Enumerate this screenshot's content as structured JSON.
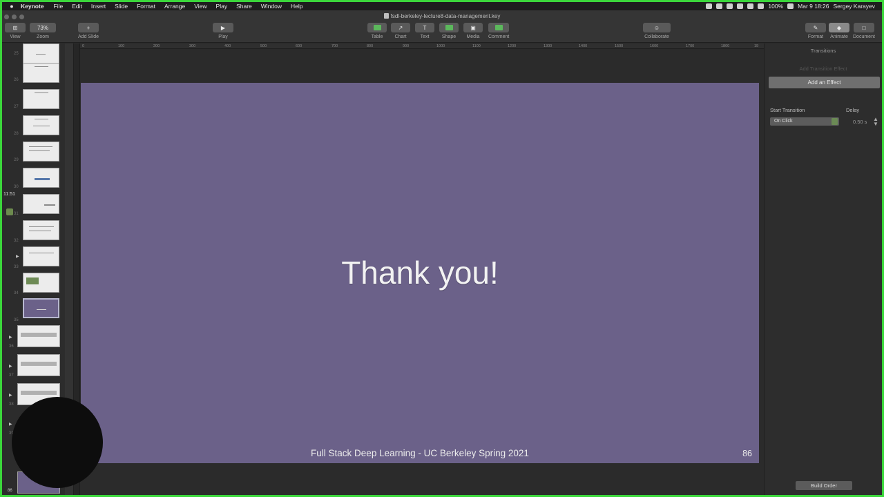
{
  "menubar": {
    "app": "Keynote",
    "items": [
      "File",
      "Edit",
      "Insert",
      "Slide",
      "Format",
      "Arrange",
      "View",
      "Play",
      "Share",
      "Window",
      "Help"
    ],
    "battery": "100%",
    "clock": "Mar 9  18:26",
    "user": "Sergey Karayev"
  },
  "window": {
    "title": "fsdl-berkeley-lecture8-data-management.key"
  },
  "toolbar": {
    "view_value": "⊞",
    "view_label": "View",
    "zoom_value": "73%",
    "zoom_label": "Zoom",
    "add_slide_label": "Add Slide",
    "play_label": "Play",
    "table_label": "Table",
    "chart_label": "Chart",
    "text_label": "Text",
    "shape_label": "Shape",
    "media_label": "Media",
    "comment_label": "Comment",
    "collaborate_label": "Collaborate",
    "format_label": "Format",
    "animate_label": "Animate",
    "document_label": "Document"
  },
  "ruler": {
    "ticks": [
      "0",
      "100",
      "200",
      "300",
      "400",
      "500",
      "600",
      "700",
      "800",
      "900",
      "1000",
      "1100",
      "1200",
      "1300",
      "1400",
      "1500",
      "1600",
      "1700",
      "1800",
      "19"
    ]
  },
  "navigator": {
    "slide_numbers": [
      "25",
      "26",
      "27",
      "28",
      "29",
      "30",
      "31",
      "32",
      "33",
      "34",
      "35",
      "36",
      "37",
      "38",
      "39"
    ],
    "last_number": "86",
    "side_time": "11:51"
  },
  "slide": {
    "title": "Thank you!",
    "footer": "Full Stack Deep Learning - UC Berkeley Spring 2021",
    "number": "86",
    "background": "#6b6189"
  },
  "inspector": {
    "heading": "Transitions",
    "hint": "Add Transition Effect",
    "add_effect": "Add an Effect",
    "start_transition_label": "Start Transition",
    "delay_label": "Delay",
    "start_value": "On Click",
    "delay_value": "0.50 s",
    "build_order": "Build Order"
  }
}
